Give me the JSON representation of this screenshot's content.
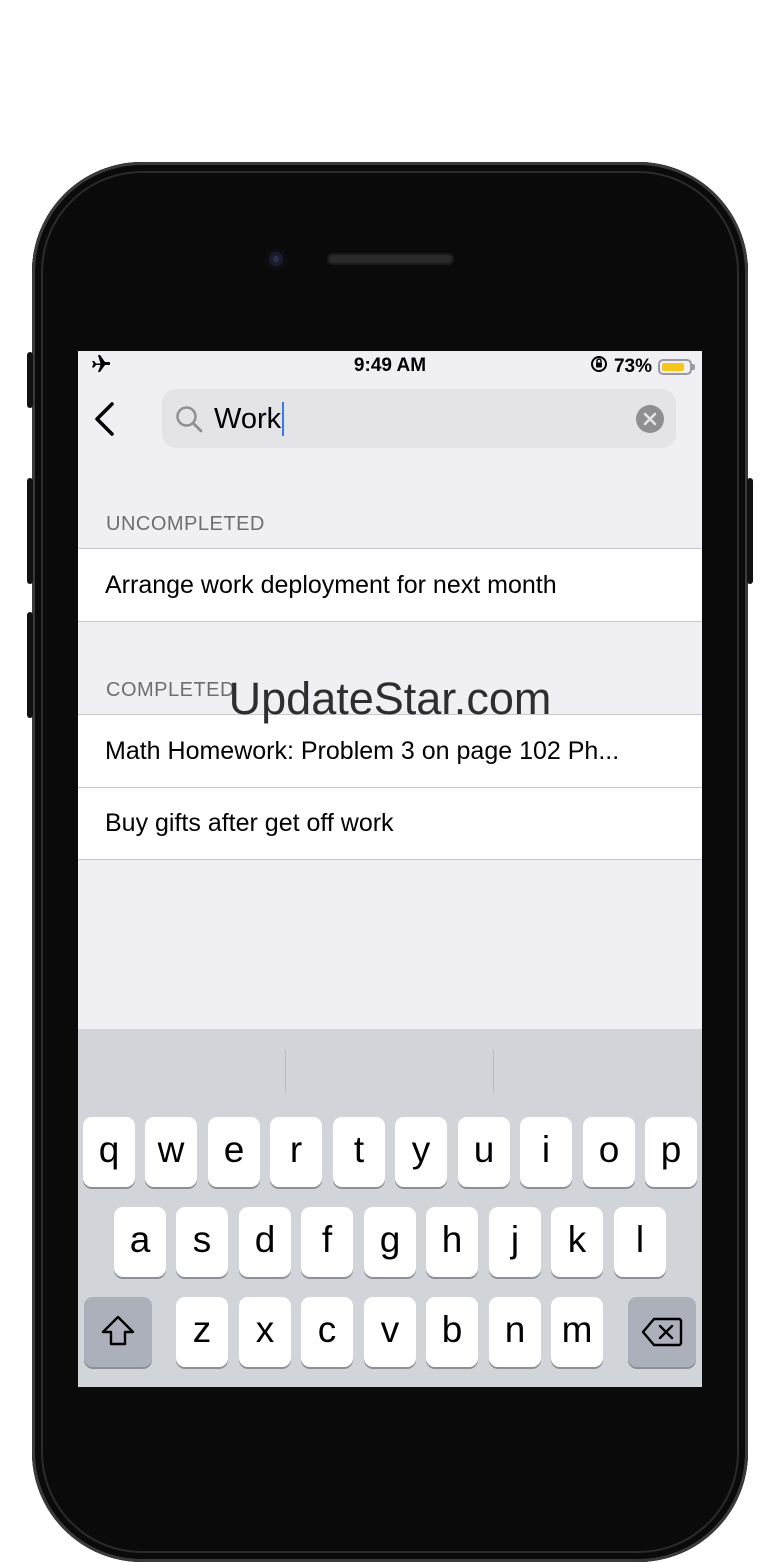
{
  "status_bar": {
    "time": "9:49 AM",
    "battery_percent": "73%",
    "battery_level": 0.73,
    "icons": [
      "airplane-icon",
      "orientation-lock-icon",
      "battery-icon"
    ]
  },
  "search": {
    "value": "Work",
    "icons": [
      "search-icon",
      "clear-icon"
    ]
  },
  "sections": {
    "uncompleted": {
      "label": "UNCOMPLETED",
      "items": [
        "Arrange work deployment for next month"
      ]
    },
    "completed": {
      "label": "COMPLETED",
      "items": [
        "Math Homework: Problem 3 on page 102   Ph...",
        "Buy gifts after get off work"
      ]
    }
  },
  "watermark": "UpdateStar.com",
  "keyboard": {
    "row1": [
      "q",
      "w",
      "e",
      "r",
      "t",
      "y",
      "u",
      "i",
      "o",
      "p"
    ],
    "row2": [
      "a",
      "s",
      "d",
      "f",
      "g",
      "h",
      "j",
      "k",
      "l"
    ],
    "row3": [
      "z",
      "x",
      "c",
      "v",
      "b",
      "n",
      "m"
    ],
    "shift_icon": "shift-icon",
    "delete_icon": "backspace-icon"
  },
  "colors": {
    "background": "#efeff4",
    "caret": "#3478f6",
    "battery": "#f7c51c",
    "section_label": "#6d6d72"
  }
}
